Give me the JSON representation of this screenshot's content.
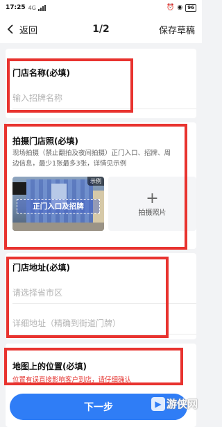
{
  "status_bar": {
    "time": "17:25",
    "network": "4G",
    "battery": "96"
  },
  "nav": {
    "back_label": "返回",
    "page_indicator": "1/2",
    "save_draft_label": "保存草稿"
  },
  "store_name": {
    "title": "门店名称(必填)",
    "placeholder": "输入招牌名称"
  },
  "store_photo": {
    "title": "拍摄门店照(必填)",
    "description": "现场拍摄（禁止翻拍及夜间拍摄）正门入口、招牌、周边信息，最少1张最多3张，详情见示例",
    "example_badge": "示例",
    "example_caption": "正门入口及招牌",
    "add_photo_label": "拍摄照片"
  },
  "store_address": {
    "title": "门店地址(必填)",
    "region_placeholder": "请选择省市区",
    "detail_placeholder": "详细地址（精确到街道门牌）"
  },
  "map_location": {
    "title": "地图上的位置(必填)",
    "warning": "位置有误直接影响客户到店，请仔细确认"
  },
  "next_button": {
    "label": "下一步"
  },
  "watermark": {
    "text": "游侠网"
  },
  "colors": {
    "accent": "#2f7df6",
    "highlight_frame": "#e8332f",
    "warning": "#e53935"
  }
}
